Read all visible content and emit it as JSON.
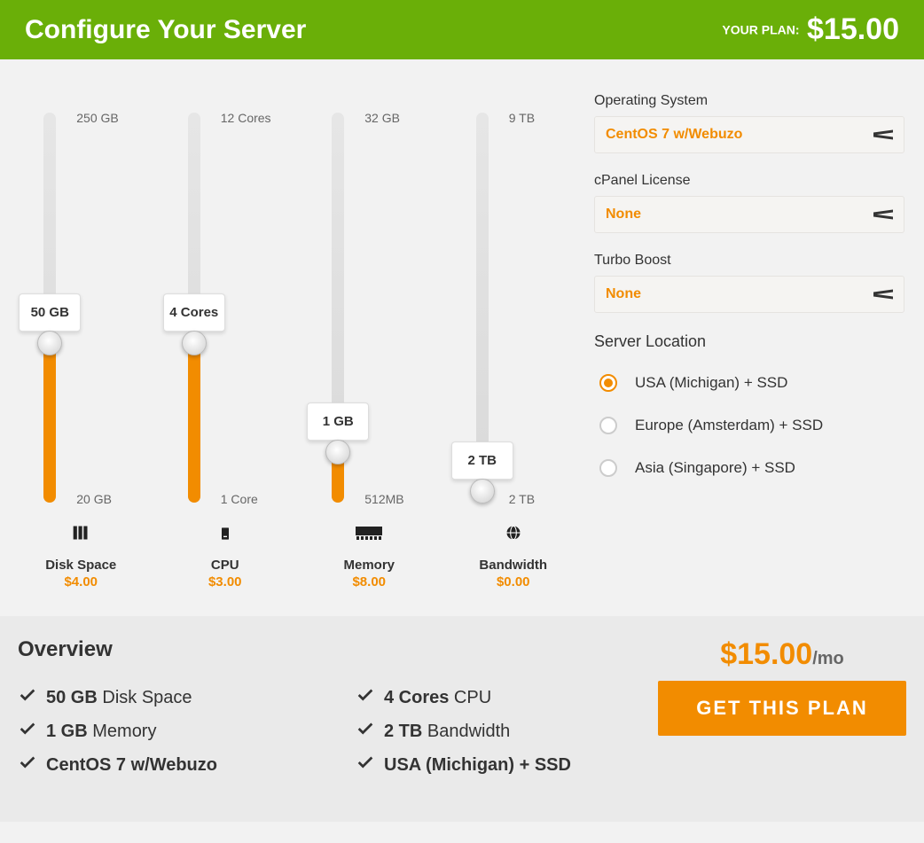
{
  "header": {
    "title": "Configure Your Server",
    "plan_label": "YOUR PLAN:",
    "plan_price": "$15.00"
  },
  "sliders": [
    {
      "key": "disk",
      "title": "Disk Space",
      "price": "$4.00",
      "min": "20 GB",
      "max": "250 GB",
      "value": "50 GB",
      "fill_pct": 41,
      "icon": "servers-icon"
    },
    {
      "key": "cpu",
      "title": "CPU",
      "price": "$3.00",
      "min": "1 Core",
      "max": "12 Cores",
      "value": "4 Cores",
      "fill_pct": 41,
      "icon": "server-icon"
    },
    {
      "key": "mem",
      "title": "Memory",
      "price": "$8.00",
      "min": "512MB",
      "max": "32 GB",
      "value": "1 GB",
      "fill_pct": 13,
      "icon": "ram-icon"
    },
    {
      "key": "bw",
      "title": "Bandwidth",
      "price": "$0.00",
      "min": "2 TB",
      "max": "9 TB",
      "value": "2 TB",
      "fill_pct": 3,
      "icon": "globe-icon"
    }
  ],
  "fields": {
    "os": {
      "label": "Operating System",
      "value": "CentOS 7 w/Webuzo"
    },
    "cpanel": {
      "label": "cPanel License",
      "value": "None"
    },
    "turbo": {
      "label": "Turbo Boost",
      "value": "None"
    }
  },
  "server_location": {
    "label": "Server Location",
    "options": [
      {
        "label": "USA (Michigan) + SSD",
        "selected": true
      },
      {
        "label": "Europe (Amsterdam) + SSD",
        "selected": false
      },
      {
        "label": "Asia (Singapore) + SSD",
        "selected": false
      }
    ]
  },
  "overview": {
    "title": "Overview",
    "lines_col1": [
      {
        "bold": "50 GB",
        "rest": " Disk Space"
      },
      {
        "bold": "1 GB",
        "rest": " Memory"
      },
      {
        "bold": "CentOS 7 w/Webuzo",
        "rest": ""
      }
    ],
    "lines_col2": [
      {
        "bold": "4 Cores",
        "rest": " CPU"
      },
      {
        "bold": "2 TB",
        "rest": " Bandwidth"
      },
      {
        "bold": "USA (Michigan) + SSD",
        "rest": ""
      }
    ],
    "price_big": "$15.00",
    "price_suffix": "/mo",
    "cta": "GET THIS PLAN"
  }
}
